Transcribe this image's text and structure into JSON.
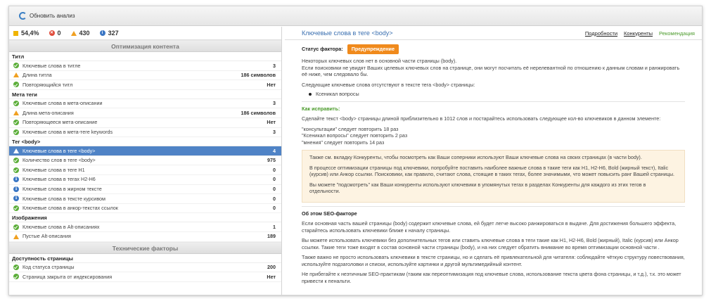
{
  "toolbar": {
    "refresh_label": "Обновить анализ"
  },
  "stats": {
    "score": "54,4%",
    "errors": "0",
    "warnings": "430",
    "info": "327"
  },
  "sections": [
    {
      "title": "Оптимизация контента",
      "groups": [
        {
          "title": "Титл",
          "rows": [
            {
              "status": "ok",
              "label": "Ключевые слова в титле",
              "value": "3"
            },
            {
              "status": "warn",
              "label": "Длина титла",
              "value": "186 символов"
            },
            {
              "status": "ok",
              "label": "Повторяющийся титл",
              "value": "Нет"
            }
          ]
        },
        {
          "title": "Мета теги",
          "rows": [
            {
              "status": "ok",
              "label": "Ключевые слова в мета-описании",
              "value": "3"
            },
            {
              "status": "warn",
              "label": "Длина мета-описания",
              "value": "186 символов"
            },
            {
              "status": "ok",
              "label": "Повторяющееся мета-описание",
              "value": "Нет"
            },
            {
              "status": "ok",
              "label": "Ключевые слова в мета-теге keywords",
              "value": "3"
            }
          ]
        },
        {
          "title": "Тег <body>",
          "rows": [
            {
              "status": "warn",
              "label": "Ключевые слова в теге <body>",
              "value": "4",
              "selected": true
            },
            {
              "status": "ok",
              "label": "Количество слов в теге <body>",
              "value": "975"
            },
            {
              "status": "ok",
              "label": "Ключевые слова в теге H1",
              "value": "0"
            },
            {
              "status": "info",
              "label": "Ключевые слова в тегах H2-H6",
              "value": "0"
            },
            {
              "status": "info",
              "label": "Ключевые слова в жирном тексте",
              "value": "0"
            },
            {
              "status": "info",
              "label": "Ключевые слова в тексте курсивом",
              "value": "0"
            },
            {
              "status": "ok",
              "label": "Ключевые слова в анкор-текстах ссылок",
              "value": "0"
            }
          ]
        },
        {
          "title": "Изображения",
          "rows": [
            {
              "status": "ok",
              "label": "Ключевые слова в Alt-описаниях",
              "value": "1"
            },
            {
              "status": "warn",
              "label": "Пустые Alt-описания",
              "value": "189"
            }
          ]
        }
      ]
    },
    {
      "title": "Технические факторы",
      "groups": [
        {
          "title": "Доступность страницы",
          "rows": [
            {
              "status": "ok",
              "label": "Код статуса страницы",
              "value": "200"
            },
            {
              "status": "ok",
              "label": "Страница закрыта от индексирования",
              "value": "Нет"
            }
          ]
        }
      ]
    }
  ],
  "detail": {
    "title": "Ключевые слова в теге <body>",
    "tabs": [
      "Подробности",
      "Конкуренты",
      "Рекомендация"
    ],
    "status_label": "Статус фактора:",
    "status_badge": "Предупреждение",
    "intro1": "Некоторых ключевых слов нет в основной части страницы (body).",
    "intro2": "Если поисковики не увидят Ваших целевых ключевых слов на странице, они могут посчитать её нерелевантной по отношению к данным словам и ранжировать её ниже, чем следовало бы.",
    "missing_label": "Следующие ключевые слова отсутствуют в тексте тега <body> страницы:",
    "missing_item": "Ксеникал вопросы",
    "fix_title": "Как исправить:",
    "fix_text": "Сделайте текст <body> страницы длиной приблизительно в 1012 слов и постарайтесь использовать следующее кол-во ключевиков в данном элементе:",
    "repeats": [
      "\"консультации\" следует повторить 18 раз",
      "\"Ксеникал вопросы\" следует повторить 2 раз",
      "\"мнения\" следует повторить 14 раз"
    ],
    "tip1": "Также см. вкладку Конкуренты, чтобы посмотреть как Ваши соперники используют Ваши ключевые слова на своих страницах (в части body).",
    "tip2": "В процессе оптимизации страницы под ключевики, попробуйте поставить наиболее важные слова в такие теги как H1, H2-H6, Bold (жирный текст), Italic (курсив) или Анкор ссылки. Поисковики, как правило, считают слова, стоящие в таких тегах, более значимыми, что может повысить ранг Вашей страницы.",
    "tip3": "Вы можете \"подсмотреть\" как Ваши конкуренты используют ключевики в упомянутых тегах в разделах Конкуренты для каждого из этих тегов в отдельности.",
    "about_title": "Об этом SEO-факторе",
    "about1": "Если основная часть вашей страницы (body) содержит ключевые слова, ей будет легче высоко ранжироваться в выдаче. Для достижения большего эффекта, старайтесь использовать ключевики ближе к началу страницы.",
    "about2": "Вы можете использовать ключевики без дополнительных тегов или ставить ключевые слова в теги такие как H1, H2-H6, Bold (жирный), Italic (курсив) или Анкор ссылки. Такие теги тоже входят в состав основной части страницы (body), и на них следует обратить внимание во время оптимизации основной части .",
    "about3": "Также важно не просто использовать ключевики в тексте страницы, но и сделать её привлекательной для читателя: соблюдайте чёткую структуру повествования, используйте подзаголовки и списки, используйте картинки и другой мультимедийный контент.",
    "about4": "Не прибегайте к неэтичным SEO-практикам (таким как переоптимизация под ключевые слова, использование текста цвета фона страницы, и т.д.), т.к. это может привести к пенальти."
  }
}
